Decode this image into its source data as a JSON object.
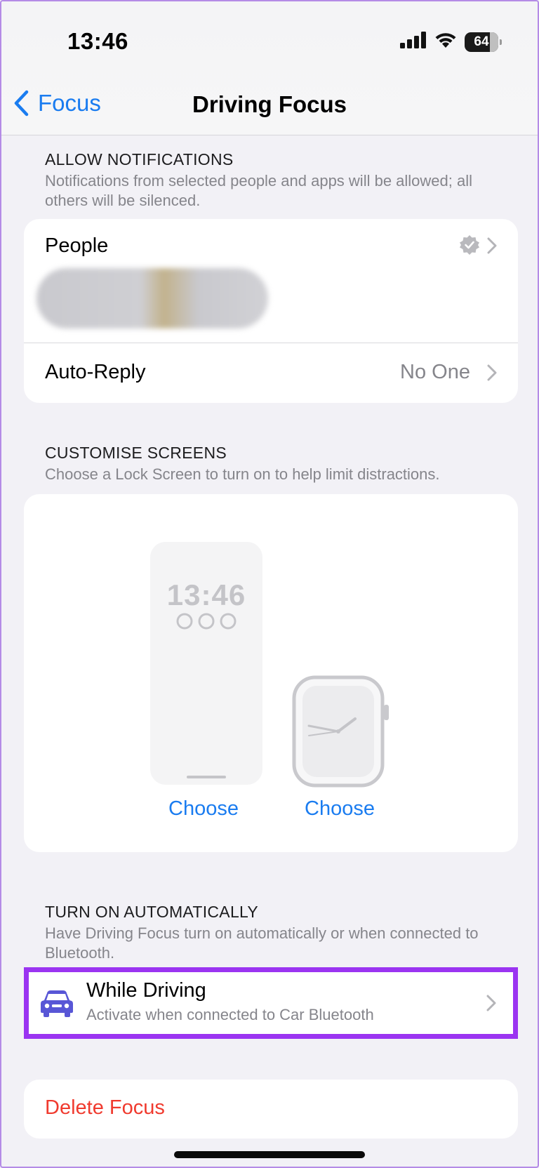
{
  "status_bar": {
    "time": "13:46",
    "battery": "64",
    "icons": [
      "signal-icon",
      "wifi-icon",
      "battery-icon"
    ]
  },
  "nav": {
    "back_label": "Focus",
    "title": "Driving Focus"
  },
  "allow_notifications": {
    "header": "ALLOW NOTIFICATIONS",
    "description": "Notifications from selected people and apps will be allowed; all others will be silenced.",
    "people_label": "People",
    "auto_reply_label": "Auto-Reply",
    "auto_reply_value": "No One"
  },
  "customise_screens": {
    "header": "CUSTOMISE SCREENS",
    "description": "Choose a Lock Screen to turn on to help limit distractions.",
    "lock_screen_time": "13:46",
    "choose_phone": "Choose",
    "choose_watch": "Choose"
  },
  "turn_on_automatically": {
    "header": "TURN ON AUTOMATICALLY",
    "description": "Have Driving Focus turn on automatically or when connected to Bluetooth.",
    "while_driving_title": "While Driving",
    "while_driving_subtitle": "Activate when connected to Car Bluetooth"
  },
  "delete_label": "Delete Focus",
  "colors": {
    "accent": "#1a7cf0",
    "destructive": "#f03a2e",
    "highlight": "#9b34f1",
    "car_icon": "#5856d6"
  }
}
